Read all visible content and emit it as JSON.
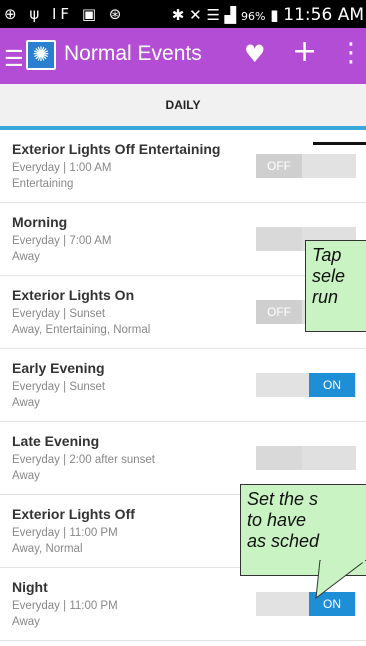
{
  "status_bar": {
    "left_icons": "⊕ ψ IF ▣ ⊛",
    "right_icons": "✱ ✕ ☰ ▟",
    "battery": "96%",
    "time": "11:56 AM"
  },
  "app_bar": {
    "title": "Normal Events",
    "drawer_glyph": "☰",
    "app_icon_glyph": "✺",
    "favorite_glyph": "♥",
    "add_glyph": "+",
    "more_glyph": "⋮"
  },
  "tab": {
    "label": "DAILY"
  },
  "events": [
    {
      "title": "Exterior Lights Off Entertaining",
      "schedule": "Everyday | 1:00 AM",
      "modes": "Entertaining",
      "toggle": "OFF",
      "state": "off"
    },
    {
      "title": "Morning",
      "schedule": "Everyday | 7:00 AM",
      "modes": "Away",
      "toggle": "",
      "state": "blank"
    },
    {
      "title": "Exterior Lights On",
      "schedule": "Everyday | Sunset",
      "modes": "Away, Entertaining, Normal",
      "toggle": "OFF",
      "state": "off"
    },
    {
      "title": "Early Evening",
      "schedule": "Everyday | Sunset",
      "modes": "Away",
      "toggle": "ON",
      "state": "on"
    },
    {
      "title": "Late Evening",
      "schedule": "Everyday | 2:00 after sunset",
      "modes": "Away",
      "toggle": "",
      "state": "blank"
    },
    {
      "title": "Exterior Lights Off",
      "schedule": "Everyday | 11:00 PM",
      "modes": "Away, Normal",
      "toggle": "",
      "state": "blank"
    },
    {
      "title": "Night",
      "schedule": "Everyday | 11:00 PM",
      "modes": "Away",
      "toggle": "ON",
      "state": "on"
    }
  ],
  "callouts": {
    "top": [
      "Tap",
      "sele",
      "run"
    ],
    "bottom": [
      "Set the s",
      "to have",
      "as sched"
    ]
  },
  "colors": {
    "app_bar": "#b44dd6",
    "tab_indicator": "#39a9dc",
    "toggle_on": "#1e8ed6",
    "callout": "#c9f3c3"
  }
}
